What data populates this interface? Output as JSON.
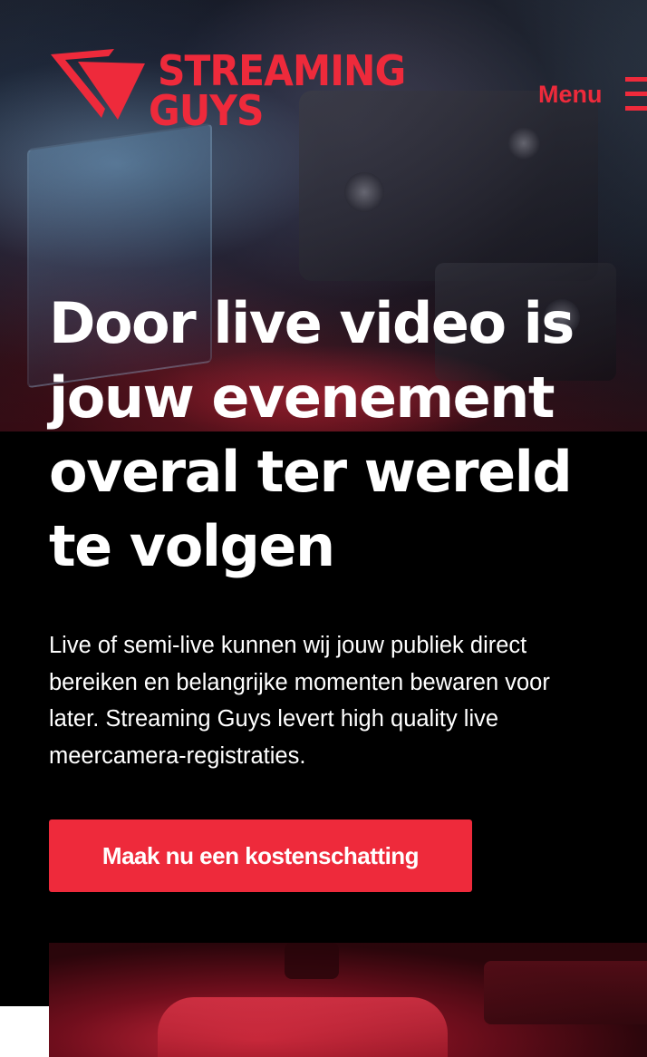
{
  "brand": {
    "name_line1": "STREAMING",
    "name_line2": "GUYS",
    "color": "#ee2a3b"
  },
  "nav": {
    "menu_label": "Menu",
    "menu_icon": "hamburger-icon"
  },
  "hero": {
    "title": "Door live video is jouw evenement overal ter wereld te volgen",
    "text": "Live of semi-live kunnen wij jouw publiek direct bereiken en belangrijke momenten bewaren voor later. Streaming Guys levert high quality live meercamera-registraties.",
    "cta_label": "Maak nu een kostenschatting"
  },
  "colors": {
    "accent": "#ee2a3b",
    "background": "#000000",
    "text": "#ffffff"
  }
}
